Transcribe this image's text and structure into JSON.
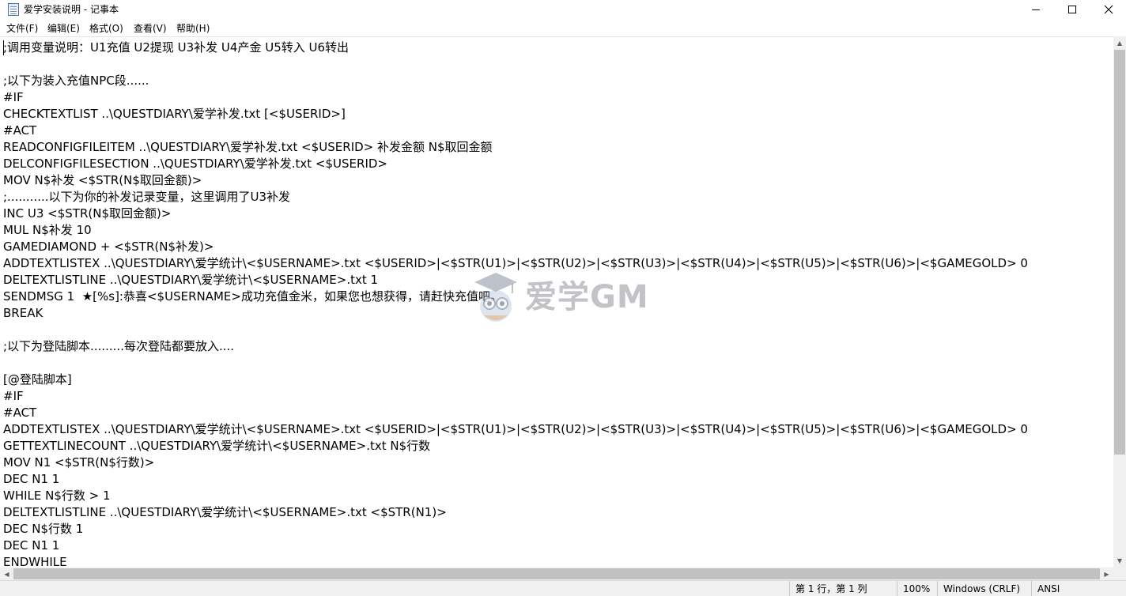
{
  "window": {
    "title": "爱学安装说明 - 记事本"
  },
  "menu": [
    {
      "label": "文件(F)"
    },
    {
      "label": "编辑(E)"
    },
    {
      "label": "格式(O)"
    },
    {
      "label": "查看(V)"
    },
    {
      "label": "帮助(H)"
    }
  ],
  "editor": {
    "lines": [
      ";调用变量说明：U1充值 U2提现 U3补发 U4产金 U5转入 U6转出",
      "",
      ";以下为装入充值NPC段......",
      "#IF",
      "CHECKTEXTLIST ..\\QUESTDIARY\\爱学补发.txt [<$USERID>]",
      "#ACT",
      "READCONFIGFILEITEM ..\\QUESTDIARY\\爱学补发.txt <$USERID> 补发金额 N$取回金额",
      "DELCONFIGFILESECTION ..\\QUESTDIARY\\爱学补发.txt <$USERID>",
      "MOV N$补发 <$STR(N$取回金额)>",
      ";...........以下为你的补发记录变量，这里调用了U3补发",
      "INC U3 <$STR(N$取回金额)>",
      "MUL N$补发 10",
      "GAMEDIAMOND + <$STR(N$补发)>",
      "ADDTEXTLISTEX ..\\QUESTDIARY\\爱学统计\\<$USERNAME>.txt <$USERID>|<$STR(U1)>|<$STR(U2)>|<$STR(U3)>|<$STR(U4)>|<$STR(U5)>|<$STR(U6)>|<$GAMEGOLD> 0",
      "DELTEXTLISTLINE ..\\QUESTDIARY\\爱学统计\\<$USERNAME>.txt 1",
      "SENDMSG 1  ★[%s]:恭喜<$USERNAME>成功充值金米，如果您也想获得，请赶快充值吧。",
      "BREAK",
      "",
      ";以下为登陆脚本.........每次登陆都要放入....",
      "",
      "[@登陆脚本]",
      "#IF",
      "#ACT",
      "ADDTEXTLISTEX ..\\QUESTDIARY\\爱学统计\\<$USERNAME>.txt <$USERID>|<$STR(U1)>|<$STR(U2)>|<$STR(U3)>|<$STR(U4)>|<$STR(U5)>|<$STR(U6)>|<$GAMEGOLD> 0",
      "GETTEXTLINECOUNT ..\\QUESTDIARY\\爱学统计\\<$USERNAME>.txt N$行数",
      "MOV N1 <$STR(N$行数)>",
      "DEC N1 1",
      "WHILE N$行数 > 1",
      "DELTEXTLISTLINE ..\\QUESTDIARY\\爱学统计\\<$USERNAME>.txt <$STR(N1)>",
      "DEC N$行数 1",
      "DEC N1 1",
      "ENDWHILE"
    ]
  },
  "watermark": {
    "text": "爱学GM",
    "icon": "owl-logo-icon"
  },
  "status": {
    "position": "第 1 行，第 1 列",
    "zoom": "100%",
    "line_ending": "Windows (CRLF)",
    "encoding": "ANSI"
  },
  "colors": {
    "background": "#ffffff",
    "chrome": "#f0f0f0",
    "text": "#000000"
  }
}
